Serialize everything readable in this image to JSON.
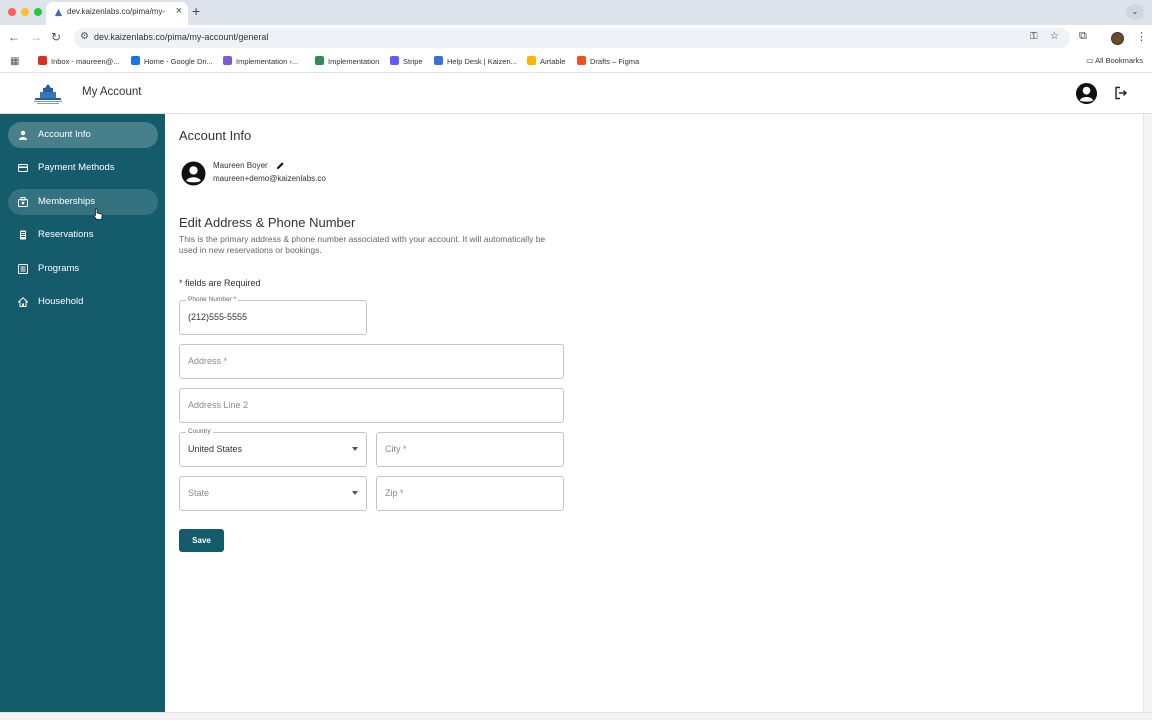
{
  "browser": {
    "tab_title": "dev.kaizenlabs.co/pima/my-",
    "url": "dev.kaizenlabs.co/pima/my-account/general",
    "bookmarks": [
      {
        "label": "Inbox - maureen@...",
        "icon": "gmail-icon",
        "color": "#d93025"
      },
      {
        "label": "Home - Google Dri...",
        "icon": "drive-icon",
        "color": "#1a73e8"
      },
      {
        "label": "Implementation ›...",
        "icon": "notion-icon",
        "color": "#7b5cd6"
      },
      {
        "label": "Implementation",
        "icon": "pen-icon",
        "color": "#2e8b57"
      },
      {
        "label": "Stripe",
        "icon": "stripe-icon",
        "color": "#635bff"
      },
      {
        "label": "Help Desk | Kaizen...",
        "icon": "helpdesk-icon",
        "color": "#3a6fd8"
      },
      {
        "label": "Airtable",
        "icon": "airtable-icon",
        "color": "#fcb400"
      },
      {
        "label": "Drafts – Figma",
        "icon": "figma-icon",
        "color": "#f24e1e"
      }
    ],
    "all_bookmarks": "All Bookmarks"
  },
  "header": {
    "title": "My Account",
    "logo_icon": "county-building-logo"
  },
  "sidebar": {
    "bg": "#145b6b",
    "items": [
      {
        "label": "Account Info",
        "icon": "person-icon"
      },
      {
        "label": "Payment Methods",
        "icon": "credit-card-icon"
      },
      {
        "label": "Memberships",
        "icon": "membership-icon"
      },
      {
        "label": "Reservations",
        "icon": "reservation-icon"
      },
      {
        "label": "Programs",
        "icon": "programs-icon"
      },
      {
        "label": "Household",
        "icon": "home-icon"
      }
    ]
  },
  "main": {
    "page_title": "Account Info",
    "user": {
      "name": "Maureen Boyer",
      "email": "maureen+demo@kaizenlabs.co"
    },
    "section_title": "Edit Address & Phone Number",
    "section_desc": "This is the primary address & phone number associated with your account. It will automatically be used in new reservations or bookings.",
    "required_note": "* fields are Required",
    "form": {
      "phone_label": "Phone Number *",
      "phone_value": "(212)555-5555",
      "address_placeholder": "Address *",
      "address2_placeholder": "Address Line 2",
      "country_label": "Country",
      "country_value": "United States",
      "city_placeholder": "City *",
      "state_placeholder": "State",
      "zip_placeholder": "Zip *",
      "save_label": "Save"
    }
  }
}
